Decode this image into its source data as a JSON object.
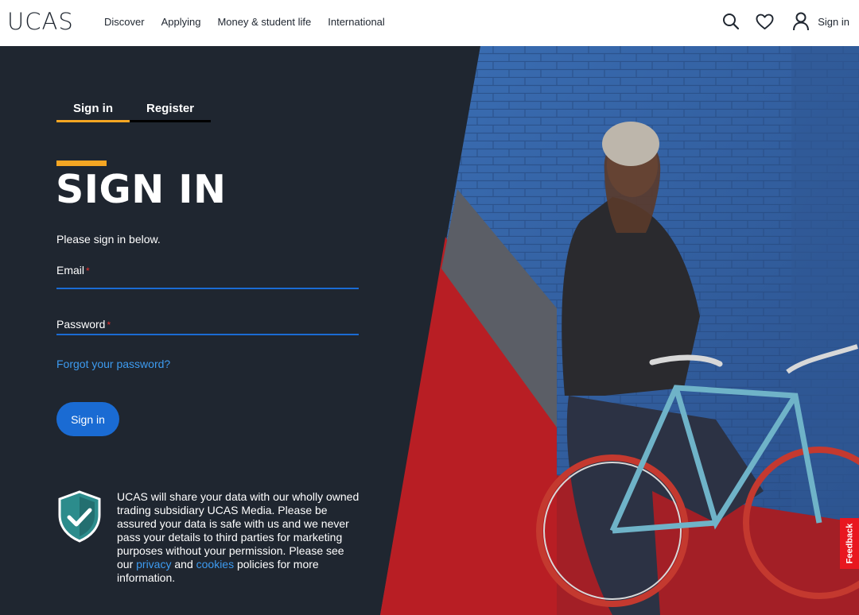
{
  "header": {
    "logo": "UCAS",
    "nav": [
      "Discover",
      "Applying",
      "Money & student life",
      "International"
    ],
    "sign_in_label": "Sign in",
    "icons": [
      "search-icon",
      "heart-icon",
      "user-icon"
    ]
  },
  "tabs": [
    {
      "label": "Sign in",
      "active": true
    },
    {
      "label": "Register",
      "active": false
    }
  ],
  "form": {
    "title": "SIGN IN",
    "intro": "Please sign in below.",
    "email_label": "Email",
    "password_label": "Password",
    "required_mark": "*",
    "email_value": "",
    "password_value": "",
    "forgot_link": "Forgot your password?",
    "submit_label": "Sign in"
  },
  "privacy": {
    "text_before": "UCAS will share your data with our wholly owned trading subsidiary UCAS Media. Please be assured your data is safe with us and we never pass your details to third parties for marketing purposes without your permission. Please see our ",
    "privacy_link": "privacy",
    "and": " and ",
    "cookies_link": "cookies",
    "text_after": " policies for more information."
  },
  "feedback_label": "Feedback",
  "colors": {
    "background": "#1f2630",
    "accent": "#f5a623",
    "primary": "#1a6bd3",
    "link": "#3d9bf0",
    "feedback": "#e8171f",
    "shield": "#2c8c8c"
  }
}
